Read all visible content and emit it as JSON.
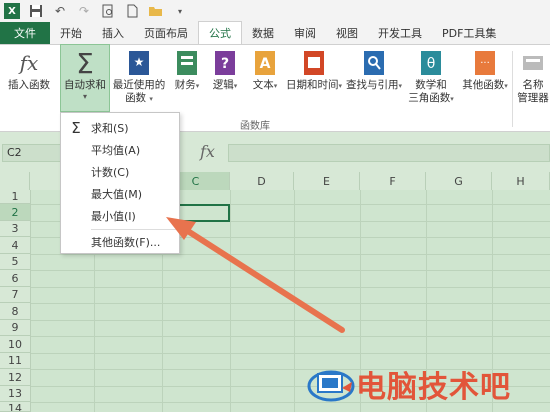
{
  "qat": {
    "logo": "X",
    "icons": [
      "save-icon",
      "undo-icon",
      "redo-icon",
      "print-preview-icon",
      "new-icon",
      "open-icon"
    ]
  },
  "tabs": [
    "文件",
    "开始",
    "插入",
    "页面布局",
    "公式",
    "数据",
    "审阅",
    "视图",
    "开发工具",
    "PDF工具集"
  ],
  "active_tab": "公式",
  "ribbon": {
    "insert_function": "插入函数",
    "autosum_line1": "自动求和",
    "recent_line1": "最近使用的",
    "recent_line2": "函数",
    "financial": "财务",
    "logical": "逻辑",
    "text": "文本",
    "datetime": "日期和时间",
    "lookup": "查找与引用",
    "math_line1": "数学和",
    "math_line2": "三角函数",
    "more": "其他函数",
    "name_line1": "名称",
    "name_line2": "管理器",
    "group_label": "函数库"
  },
  "formula_bar": {
    "name_box": "C2",
    "fx": "fx"
  },
  "grid": {
    "columns": [
      "C",
      "D",
      "E",
      "F",
      "G",
      "H"
    ],
    "rows": [
      "1",
      "2",
      "3",
      "4",
      "5",
      "6",
      "7",
      "8",
      "9",
      "10",
      "11",
      "12",
      "13",
      "14"
    ]
  },
  "autosum_menu": {
    "items": [
      "求和(S)",
      "平均值(A)",
      "计数(C)",
      "最大值(M)",
      "最小值(I)"
    ],
    "more": "其他函数(F)..."
  },
  "watermark": "电脑技术吧",
  "colors": {
    "excel_green": "#217346",
    "arrow": "#e8734e",
    "watermark": "#e2553a",
    "grid_bg": "#cfe5cf"
  }
}
